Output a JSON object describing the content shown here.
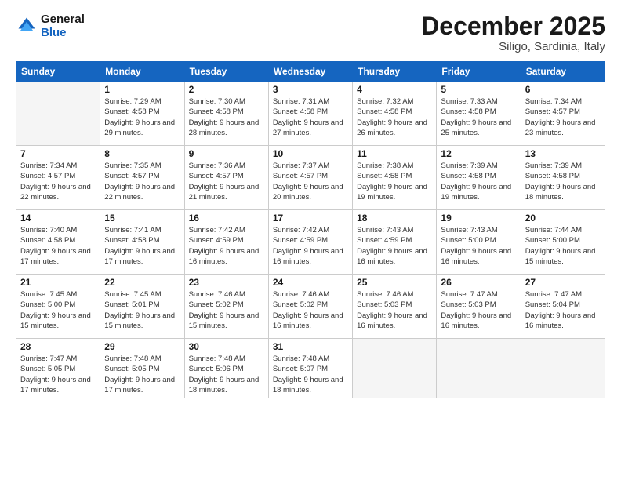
{
  "logo": {
    "line1": "General",
    "line2": "Blue"
  },
  "title": "December 2025",
  "location": "Siligo, Sardinia, Italy",
  "days_of_week": [
    "Sunday",
    "Monday",
    "Tuesday",
    "Wednesday",
    "Thursday",
    "Friday",
    "Saturday"
  ],
  "weeks": [
    [
      {
        "num": "",
        "empty": true
      },
      {
        "num": "1",
        "sunrise": "Sunrise: 7:29 AM",
        "sunset": "Sunset: 4:58 PM",
        "daylight": "Daylight: 9 hours and 29 minutes."
      },
      {
        "num": "2",
        "sunrise": "Sunrise: 7:30 AM",
        "sunset": "Sunset: 4:58 PM",
        "daylight": "Daylight: 9 hours and 28 minutes."
      },
      {
        "num": "3",
        "sunrise": "Sunrise: 7:31 AM",
        "sunset": "Sunset: 4:58 PM",
        "daylight": "Daylight: 9 hours and 27 minutes."
      },
      {
        "num": "4",
        "sunrise": "Sunrise: 7:32 AM",
        "sunset": "Sunset: 4:58 PM",
        "daylight": "Daylight: 9 hours and 26 minutes."
      },
      {
        "num": "5",
        "sunrise": "Sunrise: 7:33 AM",
        "sunset": "Sunset: 4:58 PM",
        "daylight": "Daylight: 9 hours and 25 minutes."
      },
      {
        "num": "6",
        "sunrise": "Sunrise: 7:34 AM",
        "sunset": "Sunset: 4:57 PM",
        "daylight": "Daylight: 9 hours and 23 minutes."
      }
    ],
    [
      {
        "num": "7",
        "sunrise": "Sunrise: 7:34 AM",
        "sunset": "Sunset: 4:57 PM",
        "daylight": "Daylight: 9 hours and 22 minutes."
      },
      {
        "num": "8",
        "sunrise": "Sunrise: 7:35 AM",
        "sunset": "Sunset: 4:57 PM",
        "daylight": "Daylight: 9 hours and 22 minutes."
      },
      {
        "num": "9",
        "sunrise": "Sunrise: 7:36 AM",
        "sunset": "Sunset: 4:57 PM",
        "daylight": "Daylight: 9 hours and 21 minutes."
      },
      {
        "num": "10",
        "sunrise": "Sunrise: 7:37 AM",
        "sunset": "Sunset: 4:57 PM",
        "daylight": "Daylight: 9 hours and 20 minutes."
      },
      {
        "num": "11",
        "sunrise": "Sunrise: 7:38 AM",
        "sunset": "Sunset: 4:58 PM",
        "daylight": "Daylight: 9 hours and 19 minutes."
      },
      {
        "num": "12",
        "sunrise": "Sunrise: 7:39 AM",
        "sunset": "Sunset: 4:58 PM",
        "daylight": "Daylight: 9 hours and 19 minutes."
      },
      {
        "num": "13",
        "sunrise": "Sunrise: 7:39 AM",
        "sunset": "Sunset: 4:58 PM",
        "daylight": "Daylight: 9 hours and 18 minutes."
      }
    ],
    [
      {
        "num": "14",
        "sunrise": "Sunrise: 7:40 AM",
        "sunset": "Sunset: 4:58 PM",
        "daylight": "Daylight: 9 hours and 17 minutes."
      },
      {
        "num": "15",
        "sunrise": "Sunrise: 7:41 AM",
        "sunset": "Sunset: 4:58 PM",
        "daylight": "Daylight: 9 hours and 17 minutes."
      },
      {
        "num": "16",
        "sunrise": "Sunrise: 7:42 AM",
        "sunset": "Sunset: 4:59 PM",
        "daylight": "Daylight: 9 hours and 16 minutes."
      },
      {
        "num": "17",
        "sunrise": "Sunrise: 7:42 AM",
        "sunset": "Sunset: 4:59 PM",
        "daylight": "Daylight: 9 hours and 16 minutes."
      },
      {
        "num": "18",
        "sunrise": "Sunrise: 7:43 AM",
        "sunset": "Sunset: 4:59 PM",
        "daylight": "Daylight: 9 hours and 16 minutes."
      },
      {
        "num": "19",
        "sunrise": "Sunrise: 7:43 AM",
        "sunset": "Sunset: 5:00 PM",
        "daylight": "Daylight: 9 hours and 16 minutes."
      },
      {
        "num": "20",
        "sunrise": "Sunrise: 7:44 AM",
        "sunset": "Sunset: 5:00 PM",
        "daylight": "Daylight: 9 hours and 15 minutes."
      }
    ],
    [
      {
        "num": "21",
        "sunrise": "Sunrise: 7:45 AM",
        "sunset": "Sunset: 5:00 PM",
        "daylight": "Daylight: 9 hours and 15 minutes."
      },
      {
        "num": "22",
        "sunrise": "Sunrise: 7:45 AM",
        "sunset": "Sunset: 5:01 PM",
        "daylight": "Daylight: 9 hours and 15 minutes."
      },
      {
        "num": "23",
        "sunrise": "Sunrise: 7:46 AM",
        "sunset": "Sunset: 5:02 PM",
        "daylight": "Daylight: 9 hours and 15 minutes."
      },
      {
        "num": "24",
        "sunrise": "Sunrise: 7:46 AM",
        "sunset": "Sunset: 5:02 PM",
        "daylight": "Daylight: 9 hours and 16 minutes."
      },
      {
        "num": "25",
        "sunrise": "Sunrise: 7:46 AM",
        "sunset": "Sunset: 5:03 PM",
        "daylight": "Daylight: 9 hours and 16 minutes."
      },
      {
        "num": "26",
        "sunrise": "Sunrise: 7:47 AM",
        "sunset": "Sunset: 5:03 PM",
        "daylight": "Daylight: 9 hours and 16 minutes."
      },
      {
        "num": "27",
        "sunrise": "Sunrise: 7:47 AM",
        "sunset": "Sunset: 5:04 PM",
        "daylight": "Daylight: 9 hours and 16 minutes."
      }
    ],
    [
      {
        "num": "28",
        "sunrise": "Sunrise: 7:47 AM",
        "sunset": "Sunset: 5:05 PM",
        "daylight": "Daylight: 9 hours and 17 minutes."
      },
      {
        "num": "29",
        "sunrise": "Sunrise: 7:48 AM",
        "sunset": "Sunset: 5:05 PM",
        "daylight": "Daylight: 9 hours and 17 minutes."
      },
      {
        "num": "30",
        "sunrise": "Sunrise: 7:48 AM",
        "sunset": "Sunset: 5:06 PM",
        "daylight": "Daylight: 9 hours and 18 minutes."
      },
      {
        "num": "31",
        "sunrise": "Sunrise: 7:48 AM",
        "sunset": "Sunset: 5:07 PM",
        "daylight": "Daylight: 9 hours and 18 minutes."
      },
      {
        "num": "",
        "empty": true
      },
      {
        "num": "",
        "empty": true
      },
      {
        "num": "",
        "empty": true
      }
    ]
  ]
}
